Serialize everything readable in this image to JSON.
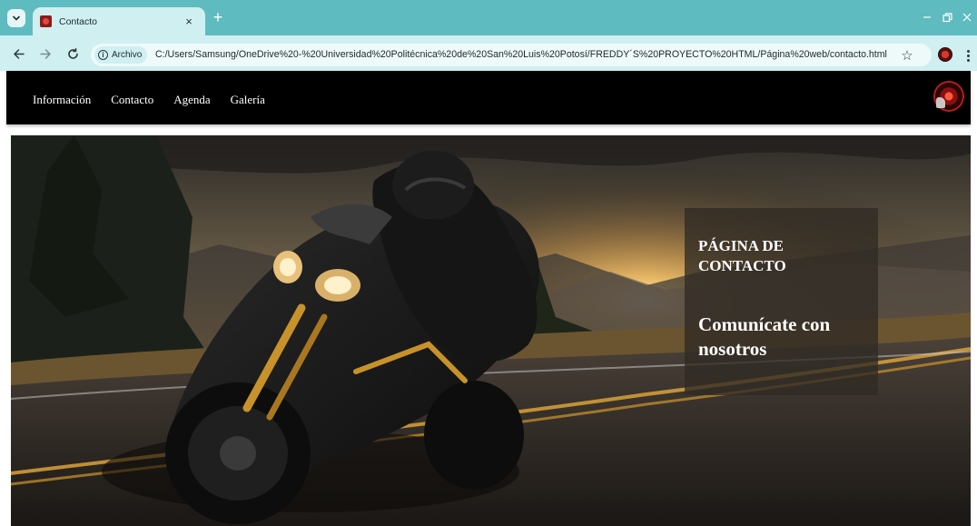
{
  "browser": {
    "tab": {
      "title": "Contacto",
      "close_glyph": "×"
    },
    "new_tab_glyph": "+",
    "site_chip": "Archivo",
    "url": "C:/Users/Samsung/OneDrive%20-%20Universidad%20Politécnica%20de%20San%20Luis%20Potosí/FREDDY´S%20PROYECTO%20HTML/Página%20web/contacto.html",
    "icons": [
      "chevron-down-icon",
      "favicon-icon",
      "close-icon",
      "plus-icon",
      "back-arrow-icon",
      "forward-arrow-icon",
      "reload-icon",
      "info-icon",
      "star-icon",
      "profile-icon",
      "kebab-menu-icon",
      "minimize-icon",
      "restore-icon",
      "window-close-icon"
    ],
    "colors": {
      "tabbar": "#5ebbc0",
      "toolbar": "#cfeff1"
    }
  },
  "site": {
    "nav": [
      {
        "label": "Información"
      },
      {
        "label": "Contacto"
      },
      {
        "label": "Agenda"
      },
      {
        "label": "Galería"
      }
    ],
    "hero": {
      "title": "PÁGINA DE CONTACTO",
      "subtitle": "Comunícate con nosotros"
    },
    "colors": {
      "nav_bg": "#000000",
      "card_bg": "#302a24"
    }
  }
}
